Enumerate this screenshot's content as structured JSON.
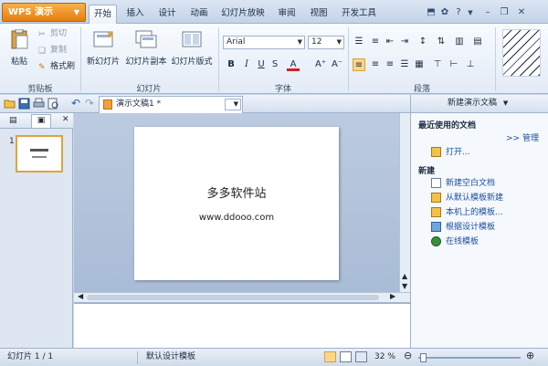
{
  "app": {
    "menu_label": "WPS 演示"
  },
  "ribbon_tabs": [
    "开始",
    "插入",
    "设计",
    "动画",
    "幻灯片放映",
    "审阅",
    "视图",
    "开发工具"
  ],
  "clipboard": {
    "paste": "粘贴",
    "cut": "剪切",
    "copy": "复制",
    "format_painter": "格式刷",
    "group": "剪贴板"
  },
  "slides_group": {
    "new_slide": "新幻灯片",
    "duplicate": "幻灯片副本",
    "layout": "幻灯片版式",
    "group": "幻灯片"
  },
  "font": {
    "name": "Arial",
    "size": "12",
    "group": "字体"
  },
  "paragraph": {
    "group": "段落"
  },
  "document": {
    "tab_title": "演示文稿1 *"
  },
  "slide": {
    "title": "多多软件站",
    "subtitle": "www.ddooo.com"
  },
  "thumbnails": {
    "slide_number": "1"
  },
  "task_pane": {
    "header": "新建演示文稿",
    "recent_heading": "最近使用的文档",
    "manage": ">> 管理",
    "open": "打开...",
    "new_heading": "新建",
    "new_items": [
      "新建空白文档",
      "从默认模板新建",
      "本机上的模板...",
      "根据设计模板",
      "在线模板"
    ]
  },
  "status": {
    "slide_position": "幻灯片 1 / 1",
    "template": "默认设计模板",
    "zoom": "32 %"
  },
  "colors": {
    "accent_orange": "#e57e10",
    "link_blue": "#1b4fa0",
    "ribbon_blue": "#c3d3e7"
  }
}
